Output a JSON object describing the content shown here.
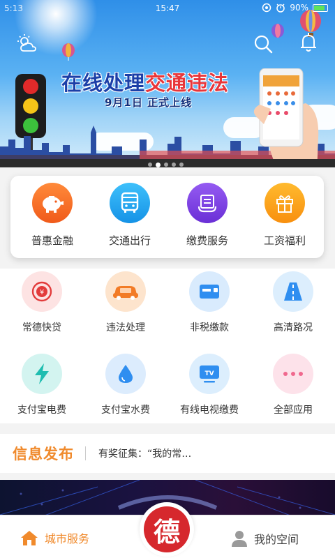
{
  "status_bar": {
    "left": "5:13",
    "time": "15:47",
    "battery": "90%"
  },
  "banner": {
    "title_part1": "在线处理",
    "title_part2": "交通",
    "title_part3": "违法",
    "subtitle": "9月1日   正式上线",
    "active_slide": 2,
    "slides": 5
  },
  "header_icons": [
    "weather-icon",
    "search-icon",
    "bell-icon"
  ],
  "main_services": [
    {
      "label": "普惠金融",
      "icon": "piggy-bank-icon",
      "color": "#f4641e"
    },
    {
      "label": "交通出行",
      "icon": "bus-icon",
      "color": "#1da3f0"
    },
    {
      "label": "缴费服务",
      "icon": "payment-icon",
      "color": "#7b3fe3"
    },
    {
      "label": "工资福利",
      "icon": "gift-icon",
      "color": "#fa9d12"
    }
  ],
  "sub_services": [
    {
      "label": "常德快贷",
      "icon": "loan-icon",
      "bg": "#fde3e3",
      "fg": "#e23b3b"
    },
    {
      "label": "违法处理",
      "icon": "car-violation-icon",
      "bg": "#fde4cd",
      "fg": "#f27b26"
    },
    {
      "label": "非税缴款",
      "icon": "card-payment-icon",
      "bg": "#d9ebfd",
      "fg": "#2f8ef0"
    },
    {
      "label": "高清路况",
      "icon": "road-icon",
      "bg": "#dceefd",
      "fg": "#2f8ef0"
    },
    {
      "label": "支付宝电费",
      "icon": "electricity-icon",
      "bg": "#d3f4f0",
      "fg": "#1fbdb0"
    },
    {
      "label": "支付宝水费",
      "icon": "water-drop-icon",
      "bg": "#dcecfd",
      "fg": "#2f8ef0"
    },
    {
      "label": "有线电视缴费",
      "icon": "tv-icon",
      "bg": "#dceefd",
      "fg": "#2f8ef0"
    },
    {
      "label": "全部应用",
      "icon": "more-icon",
      "bg": "#fde2ea",
      "fg": "#f0688e"
    }
  ],
  "news": {
    "title": "信息发布",
    "text": "有奖征集：“我的常…"
  },
  "tabbar": {
    "left_label": "城市服务",
    "right_label": "我的空间",
    "center_char": "德",
    "active_color": "#f08a2c"
  }
}
